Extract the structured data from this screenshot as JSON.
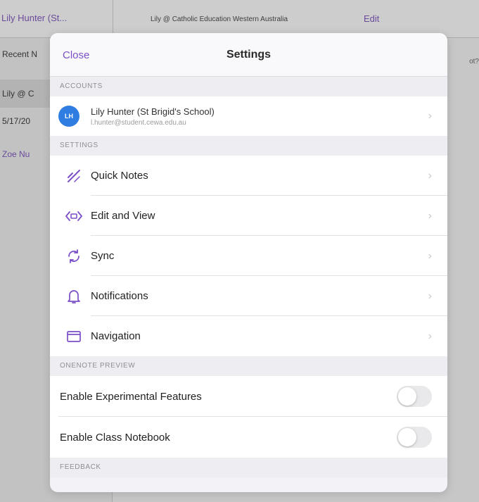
{
  "background": {
    "tabs": [
      "Lily Hunter (St...",
      "Lily @ Catholic Education Western Australia",
      "Edit"
    ],
    "sidebar_items": [
      "Recent N",
      "Lily @ C",
      "5/17/20",
      "Zoe Nu"
    ],
    "right_text": "ot?"
  },
  "sheet": {
    "close_label": "Close",
    "title": "Settings",
    "sections": {
      "accounts_header": "Accounts",
      "settings_header": "Settings",
      "preview_header": "OneNote Preview",
      "feedback_header": "Feedback"
    },
    "account": {
      "initials": "LH",
      "name": "Lily Hunter (St Brigid's School)",
      "email": "l.hunter@student.cewa.edu.au"
    },
    "settings_items": [
      {
        "label": "Quick Notes",
        "icon": "pen-icon"
      },
      {
        "label": "Edit and View",
        "icon": "edit-view-icon"
      },
      {
        "label": "Sync",
        "icon": "sync-icon"
      },
      {
        "label": "Notifications",
        "icon": "bell-icon"
      },
      {
        "label": "Navigation",
        "icon": "navigation-icon"
      }
    ],
    "preview_items": [
      {
        "label": "Enable Experimental Features",
        "enabled": false
      },
      {
        "label": "Enable Class Notebook",
        "enabled": false
      }
    ],
    "chevron": "›"
  },
  "colors": {
    "accent": "#7b4fc8",
    "avatar": "#2f7de1",
    "toggle_off": "#e9e9eb"
  }
}
